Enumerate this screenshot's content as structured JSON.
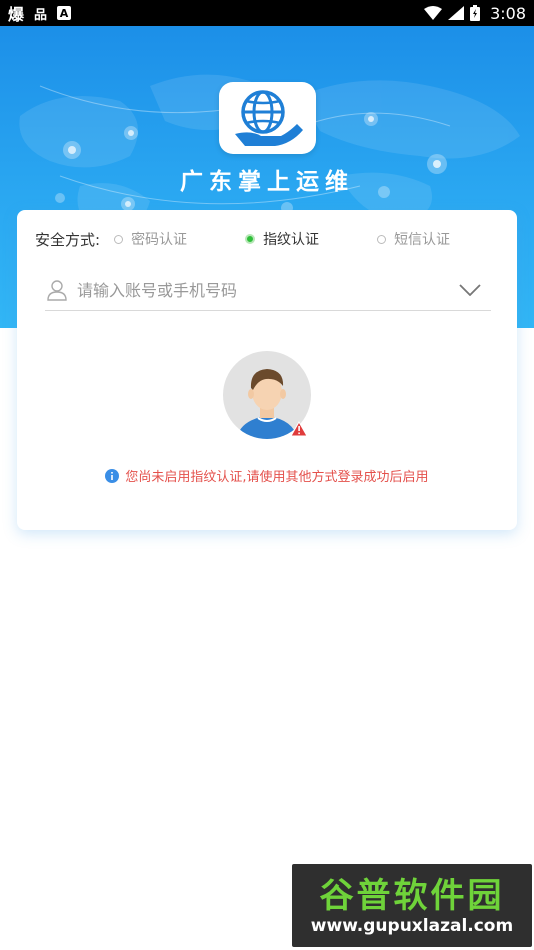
{
  "status_bar": {
    "left_glyph_1": "爆",
    "left_glyph_2": "品",
    "left_glyph_3": "A",
    "time": "3:08"
  },
  "header": {
    "app_name": "广东掌上运维",
    "logo_icon": "globe-hand-icon"
  },
  "login_card": {
    "security_label": "安全方式:",
    "auth_options": [
      {
        "label": "密码认证",
        "selected": false
      },
      {
        "label": "指纹认证",
        "selected": true
      },
      {
        "label": "短信认证",
        "selected": false
      }
    ],
    "account_input": {
      "placeholder": "请输入账号或手机号码",
      "value": ""
    },
    "notice": "您尚未启用指纹认证,请使用其他方式登录成功后启用"
  },
  "watermark": {
    "title": "谷普软件园",
    "url": "www.gupuxlazal.com"
  },
  "colors": {
    "header_gradient_start": "#1c8fe8",
    "header_gradient_end": "#32b6f5",
    "selected_radio": "#2fbf3a",
    "notice_text": "#e4514c",
    "info_icon": "#3a8ee6"
  }
}
